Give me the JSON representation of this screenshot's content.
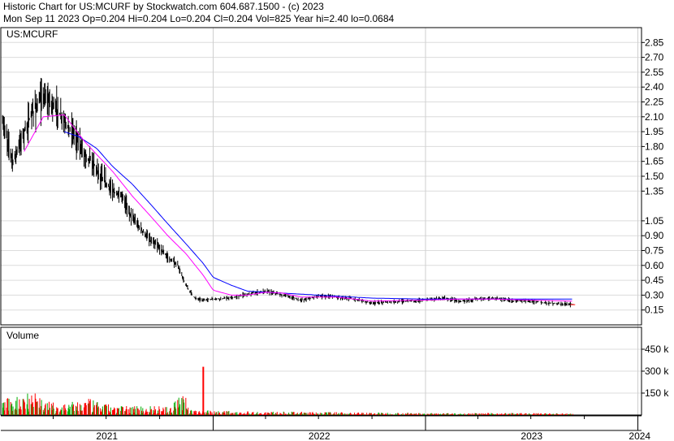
{
  "header": {
    "line1": "Historic Chart for US:MCURF by Stockwatch.com 604.687.1500 - (c) 2023",
    "line2": "Mon Sep 11 2023   Op=0.204  Hi=0.204  Lo=0.204  Cl=0.204  Vol=825  Year hi=2.40  lo=0.0684"
  },
  "chart_data": [
    {
      "type": "line",
      "title": "US:MCURF",
      "price_axis_ticks": [
        "2.85",
        "2.70",
        "2.55",
        "2.40",
        "2.25",
        "2.10",
        "1.95",
        "1.80",
        "1.65",
        "1.50",
        "1.35",
        "1.05",
        "0.90",
        "0.75",
        "0.60",
        "0.45",
        "0.30",
        "0.15"
      ],
      "x_tick_labels": [
        "2021",
        "2022",
        "2023",
        "2024"
      ],
      "ylim": [
        0.0,
        3.0
      ],
      "grid": true,
      "colors": {
        "price": "#000000",
        "ma_short": "#ff00ff",
        "ma_long": "#0000ff",
        "close_marker": "#ff0000"
      },
      "price_keypoints": {
        "x": [
          "2021-01-04",
          "2021-01-22",
          "2021-02-10",
          "2021-02-25",
          "2021-03-15",
          "2021-04-05",
          "2021-04-20",
          "2021-05-05",
          "2021-05-25",
          "2021-06-10",
          "2021-06-25",
          "2021-07-12",
          "2021-07-30",
          "2021-08-15",
          "2021-09-01",
          "2021-09-15",
          "2021-10-01",
          "2021-10-15",
          "2021-11-01",
          "2021-11-15",
          "2021-12-01",
          "2021-12-15",
          "2022-01-01",
          "2022-02-01",
          "2022-03-01",
          "2022-04-01",
          "2022-05-01",
          "2022-06-01",
          "2022-07-01",
          "2022-08-01",
          "2022-09-01",
          "2022-10-01",
          "2022-11-01",
          "2022-12-01",
          "2023-01-01",
          "2023-02-01",
          "2023-03-01",
          "2023-04-01",
          "2023-05-01",
          "2023-06-01",
          "2023-07-01",
          "2023-08-01",
          "2023-09-11"
        ],
        "y": [
          2.05,
          1.65,
          1.95,
          2.15,
          2.3,
          2.2,
          2.05,
          1.95,
          1.72,
          1.62,
          1.47,
          1.35,
          1.28,
          1.08,
          0.95,
          0.85,
          0.78,
          0.68,
          0.6,
          0.4,
          0.27,
          0.25,
          0.26,
          0.27,
          0.31,
          0.34,
          0.3,
          0.25,
          0.29,
          0.28,
          0.26,
          0.22,
          0.23,
          0.24,
          0.25,
          0.27,
          0.24,
          0.26,
          0.27,
          0.24,
          0.24,
          0.22,
          0.204
        ]
      },
      "ma_short_keypoints": {
        "x": [
          "2021-02-10",
          "2021-03-15",
          "2021-04-20",
          "2021-05-25",
          "2021-07-12",
          "2021-08-15",
          "2021-09-15",
          "2021-10-15",
          "2021-11-15",
          "2021-12-15",
          "2022-01-01",
          "2022-02-01",
          "2022-03-01",
          "2022-04-01",
          "2022-05-01",
          "2022-06-01",
          "2022-08-01",
          "2022-10-01",
          "2023-01-01",
          "2023-03-01",
          "2023-05-01",
          "2023-07-01",
          "2023-09-11"
        ],
        "y": [
          1.75,
          2.1,
          2.12,
          1.85,
          1.55,
          1.3,
          1.1,
          0.9,
          0.72,
          0.5,
          0.35,
          0.3,
          0.3,
          0.33,
          0.32,
          0.28,
          0.28,
          0.24,
          0.25,
          0.26,
          0.26,
          0.25,
          0.24
        ]
      },
      "ma_long_keypoints": {
        "x": [
          "2021-04-20",
          "2021-05-15",
          "2021-06-15",
          "2021-07-12",
          "2021-08-15",
          "2021-09-15",
          "2021-10-15",
          "2021-11-15",
          "2021-12-15",
          "2022-01-01",
          "2022-02-01",
          "2022-03-01",
          "2022-04-01",
          "2022-06-01",
          "2022-08-01",
          "2022-10-01",
          "2023-01-01",
          "2023-04-01",
          "2023-07-01",
          "2023-09-11"
        ],
        "y": [
          1.95,
          1.9,
          1.78,
          1.6,
          1.42,
          1.22,
          1.02,
          0.82,
          0.62,
          0.48,
          0.4,
          0.34,
          0.33,
          0.31,
          0.29,
          0.27,
          0.26,
          0.26,
          0.26,
          0.26
        ]
      },
      "last_close": 0.204
    },
    {
      "type": "bar",
      "title": "Volume",
      "volume_axis_ticks": [
        "450 k",
        "300 k",
        "150 k"
      ],
      "ylim": [
        0,
        600000
      ],
      "colors": {
        "up": "#00aa00",
        "down": "#ff0000"
      },
      "volume_keypoints": {
        "x": [
          "2021-01-10",
          "2021-02-01",
          "2021-02-20",
          "2021-03-20",
          "2021-04-10",
          "2021-05-01",
          "2021-06-01",
          "2021-07-01",
          "2021-08-01",
          "2021-09-01",
          "2021-10-01",
          "2021-10-20",
          "2021-11-10",
          "2021-11-20",
          "2021-12-01",
          "2022-01-01",
          "2022-03-01",
          "2022-06-01",
          "2022-09-01",
          "2022-12-01",
          "2023-03-01",
          "2023-06-01",
          "2023-09-11"
        ],
        "y": [
          90000,
          110000,
          160000,
          80000,
          60000,
          70000,
          90000,
          60000,
          50000,
          55000,
          50000,
          40000,
          160000,
          40000,
          30000,
          25000,
          20000,
          18000,
          15000,
          12000,
          10000,
          12000,
          8000
        ]
      },
      "peak": {
        "x": "2021-12-15",
        "y": 330000
      }
    }
  ]
}
